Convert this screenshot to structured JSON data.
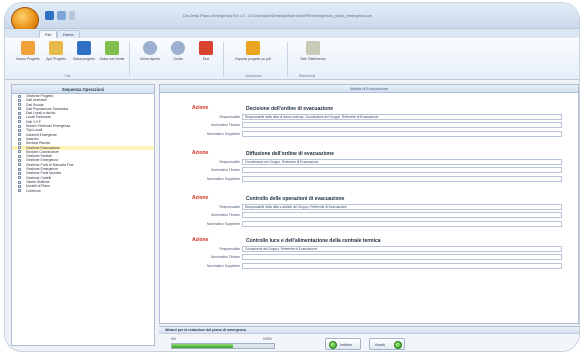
{
  "window": {
    "title": "Dis Desk Piano Emergenza Ed 1.0 - C:\\Users\\Ale\\Desktop\\Esercizio\\PiE\\emergenza_piano_emergenza.pe"
  },
  "ribbon": {
    "tabs": [
      "File",
      "Home"
    ],
    "buttons": [
      {
        "label": "Nuovo Progetto",
        "icon": "new-project-icon",
        "color": "#f2a23a"
      },
      {
        "label": "Apri Progetto",
        "icon": "open-folder-icon",
        "color": "#e7b84a"
      },
      {
        "label": "Salva progetto",
        "icon": "save-disk-icon",
        "color": "#2f6fc4"
      },
      {
        "label": "Salva con Nome",
        "icon": "save-as-icon",
        "color": "#7fbf4d"
      },
      {
        "label": "Ultimo Aperto",
        "icon": "recent-icon",
        "color": "#9bb1cf"
      },
      {
        "label": "Guida",
        "icon": "help-icon",
        "color": "#9bb1cf"
      },
      {
        "label": "Esci",
        "icon": "exit-icon",
        "color": "#d8432e"
      },
      {
        "label": "Esporta progetto su pdf",
        "icon": "export-pdf-icon",
        "color": "#e9a520"
      },
      {
        "label": "Sett. Riferimento",
        "icon": "settings-icon",
        "color": "#c9c9b8"
      }
    ],
    "group_labels": [
      "File",
      "Operazioni",
      "Riferimenti"
    ]
  },
  "sidebar": {
    "title": "Sequenza Operazioni",
    "items": [
      "Gestione Progetto",
      "Dati Aziendali",
      "Dati Scuola",
      "Dati Popolazione Scolastica",
      "Dati Locali a rischio",
      "Locali Particolari",
      "Dati V.V.F.",
      "Numeri Telefonici Emergenza",
      "Tipo Locali",
      "Incidenti Emergenze",
      "Incendio",
      "Sezione Rischio",
      "Gestione Evacuazione",
      "Sezione Coordinatore",
      "Gestione Sanitari",
      "Gestione Emergenza",
      "Gestione Punti di Raccolta Fine",
      "Gestione Emergenze",
      "Gestione Punti raccolta",
      "Gestione Cartelli",
      "Tavole Grafiche",
      "Modelli di Piano",
      "Contenuti"
    ],
    "selected_index": 12
  },
  "main": {
    "header": "Attività di Evacuazione",
    "actions": [
      {
        "label": "Azione",
        "title": "Decisione dell'ordine di evacuazione",
        "responsabile_label": "Responsabile",
        "responsabile_value": "Responsabile della ditta di lavoro esterna, Coordinatore del Gruppo, Referente di Evacuazione",
        "nominativo_label": "Nominativo Titolare",
        "nominativo_value": "",
        "supplente_label": "Nominativo Supplente",
        "supplente_value": ""
      },
      {
        "label": "Azione",
        "title": "Diffusione dell'ordine di evacuazione",
        "responsabile_label": "Responsabile",
        "responsabile_value": "Coordinatore del Gruppo, Referente di Evacuazione",
        "nominativo_label": "Nominativo Titolare",
        "nominativo_value": "",
        "supplente_label": "Nominativo Supplente",
        "supplente_value": ""
      },
      {
        "label": "Azione",
        "title": "Controllo delle operazioni di evacuazione",
        "responsabile_label": "Responsabile",
        "responsabile_value": "Responsabile della ditta o addetti del Gruppo, Referente di Evacuazione",
        "nominativo_label": "Nominativo Titolare",
        "nominativo_value": "",
        "supplente_label": "Nominativo Supplente",
        "supplente_value": ""
      },
      {
        "label": "Azione",
        "title": "Controllo luce e dell'alimentazione della centrale termica",
        "responsabile_label": "Responsabile",
        "responsabile_value": "Componenti del Gruppo, Referente di Evacuazione",
        "nominativo_label": "Nominativo Titolare",
        "nominativo_value": "",
        "supplente_label": "Nominativo Supplente",
        "supplente_value": ""
      }
    ]
  },
  "bottom": {
    "title": "Wizard per la redazione del piano di emergenza",
    "pct_start": "0%",
    "pct_end": "100%",
    "progress": 0.6,
    "back_label": "Indietro",
    "next_label": "Avanti"
  },
  "colors": {
    "accent": "#d03020",
    "progress": "#3aa12a"
  }
}
